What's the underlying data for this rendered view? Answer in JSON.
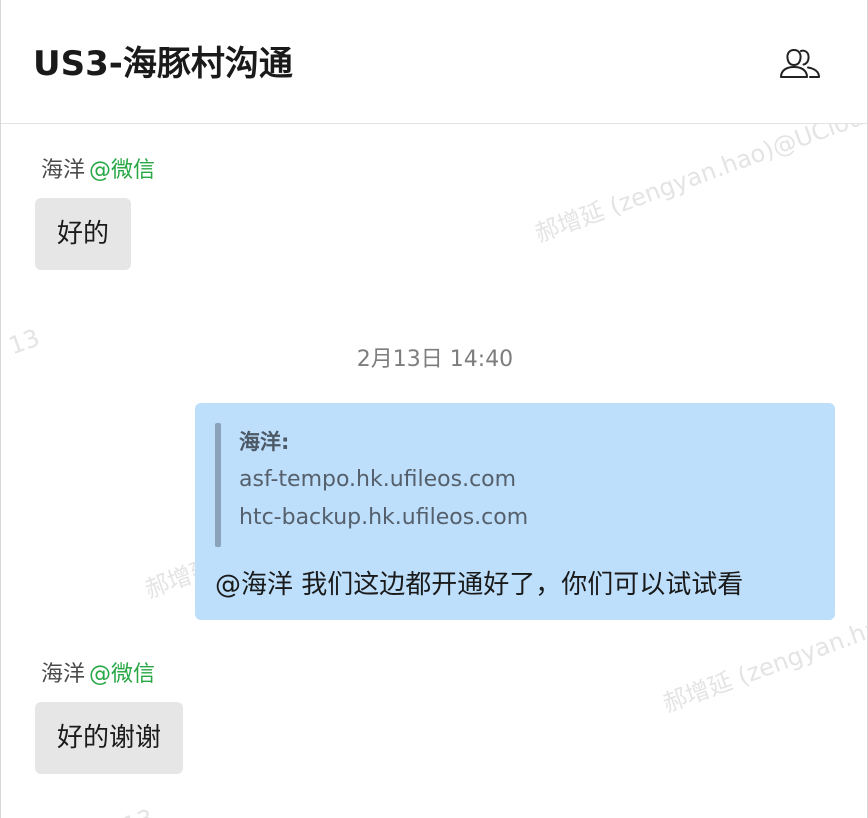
{
  "header": {
    "title": "US3-海豚村沟通",
    "members_icon": "members-icon"
  },
  "watermark": {
    "text": "郝增延 (zengyan.hao)@UCloud",
    "fragment": "13"
  },
  "messages": [
    {
      "sender": "海洋",
      "source": "@微信",
      "text": "好的"
    },
    {
      "timestamp": "2月13日 14:40"
    },
    {
      "quote": {
        "author": "海洋:",
        "lines": [
          "asf-tempo.hk.ufileos.com",
          "htc-backup.hk.ufileos.com"
        ]
      },
      "text": "@海洋 我们这边都开通好了，你们可以试试看"
    },
    {
      "sender": "海洋",
      "source": "@微信",
      "text": "好的谢谢"
    }
  ],
  "colors": {
    "outgoing_bubble": "#bddffb",
    "incoming_bubble": "#e6e6e6",
    "source_tag": "#27a844"
  }
}
